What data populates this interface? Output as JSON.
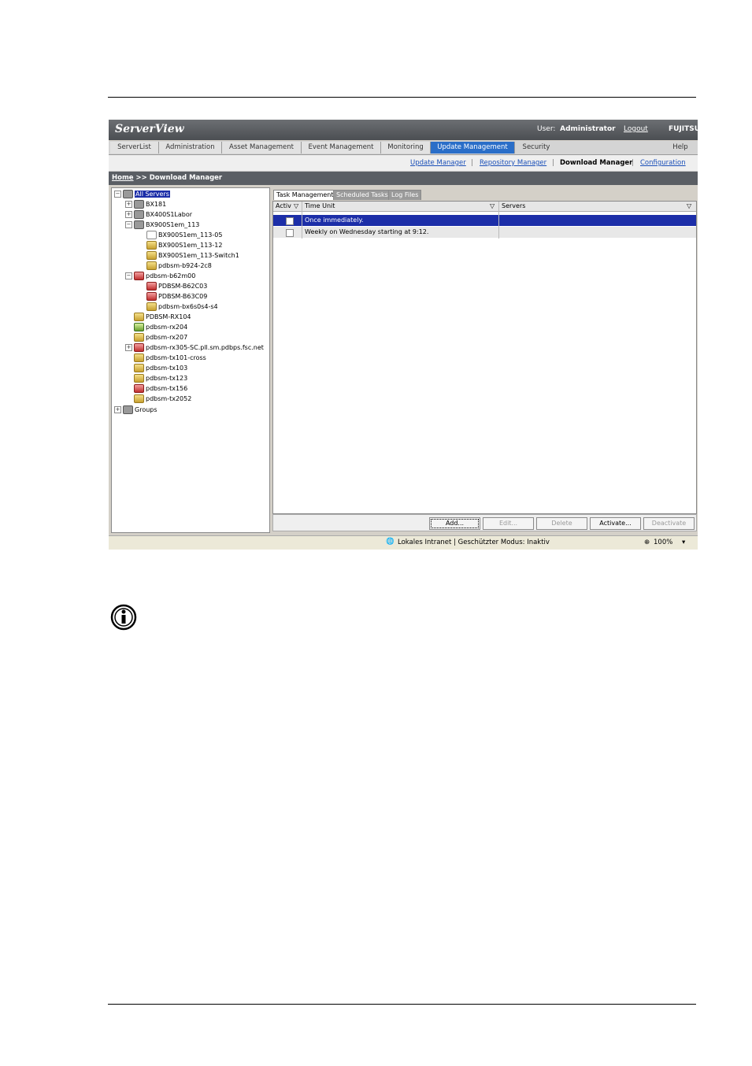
{
  "app": {
    "logo": "ServerView",
    "user_label": "User:",
    "user_name": "Administrator",
    "logout": "Logout",
    "brand": "FUJITSU"
  },
  "tabs": [
    {
      "label": "ServerList"
    },
    {
      "label": "Administration"
    },
    {
      "label": "Asset Management"
    },
    {
      "label": "Event Management"
    },
    {
      "label": "Monitoring"
    },
    {
      "label": "Update Management",
      "active": true
    },
    {
      "label": "Security"
    },
    {
      "label": "Help"
    }
  ],
  "subnav": {
    "update_manager": "Update Manager",
    "repository_manager": "Repository Manager",
    "download_manager": "Download Manager",
    "configuration": "Configuration",
    "separator": "|"
  },
  "breadcrumb": {
    "home": "Home",
    "rest": ">> Download Manager"
  },
  "tree": {
    "root": "All Servers",
    "items": [
      "BX181",
      "BX400S1Labor",
      "BX900S1em_113",
      "BX900S1em_113-05",
      "BX900S1em_113-12",
      "BX900S1em_113-Switch1",
      "pdbsm-b924-2c8",
      "pdbsm-b62m00",
      "PDBSM-B62C03",
      "PDBSM-B63C09",
      "pdbsm-bx6s0s4-s4",
      "PDBSM-RX104",
      "pdbsm-rx204",
      "pdbsm-rx207",
      "pdbsm-rx305-SC.pll.sm.pdbps.fsc.net",
      "pdbsm-tx101-cross",
      "pdbsm-tx103",
      "pdbsm-tx123",
      "pdbsm-tx156",
      "pdbsm-tx2052"
    ],
    "groups": "Groups"
  },
  "panel": {
    "tabs": [
      "Task Management",
      "Scheduled Tasks",
      "Log Files"
    ],
    "columns": {
      "active": "Activ",
      "time_unit": "Time Unit",
      "servers": "Servers"
    },
    "rows": [
      {
        "time_unit": "Once immediately."
      },
      {
        "time_unit": "Weekly on Wednesday starting at 9:12."
      }
    ],
    "buttons": {
      "add": "Add...",
      "edit": "Edit...",
      "delete": "Delete",
      "activate": "Activate...",
      "deactivate": "Deactivate"
    }
  },
  "status": {
    "zone": "Lokales Intranet | Geschützter Modus: Inaktiv",
    "zoom": "100%"
  },
  "colors": {
    "accent": "#2a6ec8",
    "selection": "#1c2ea8"
  }
}
